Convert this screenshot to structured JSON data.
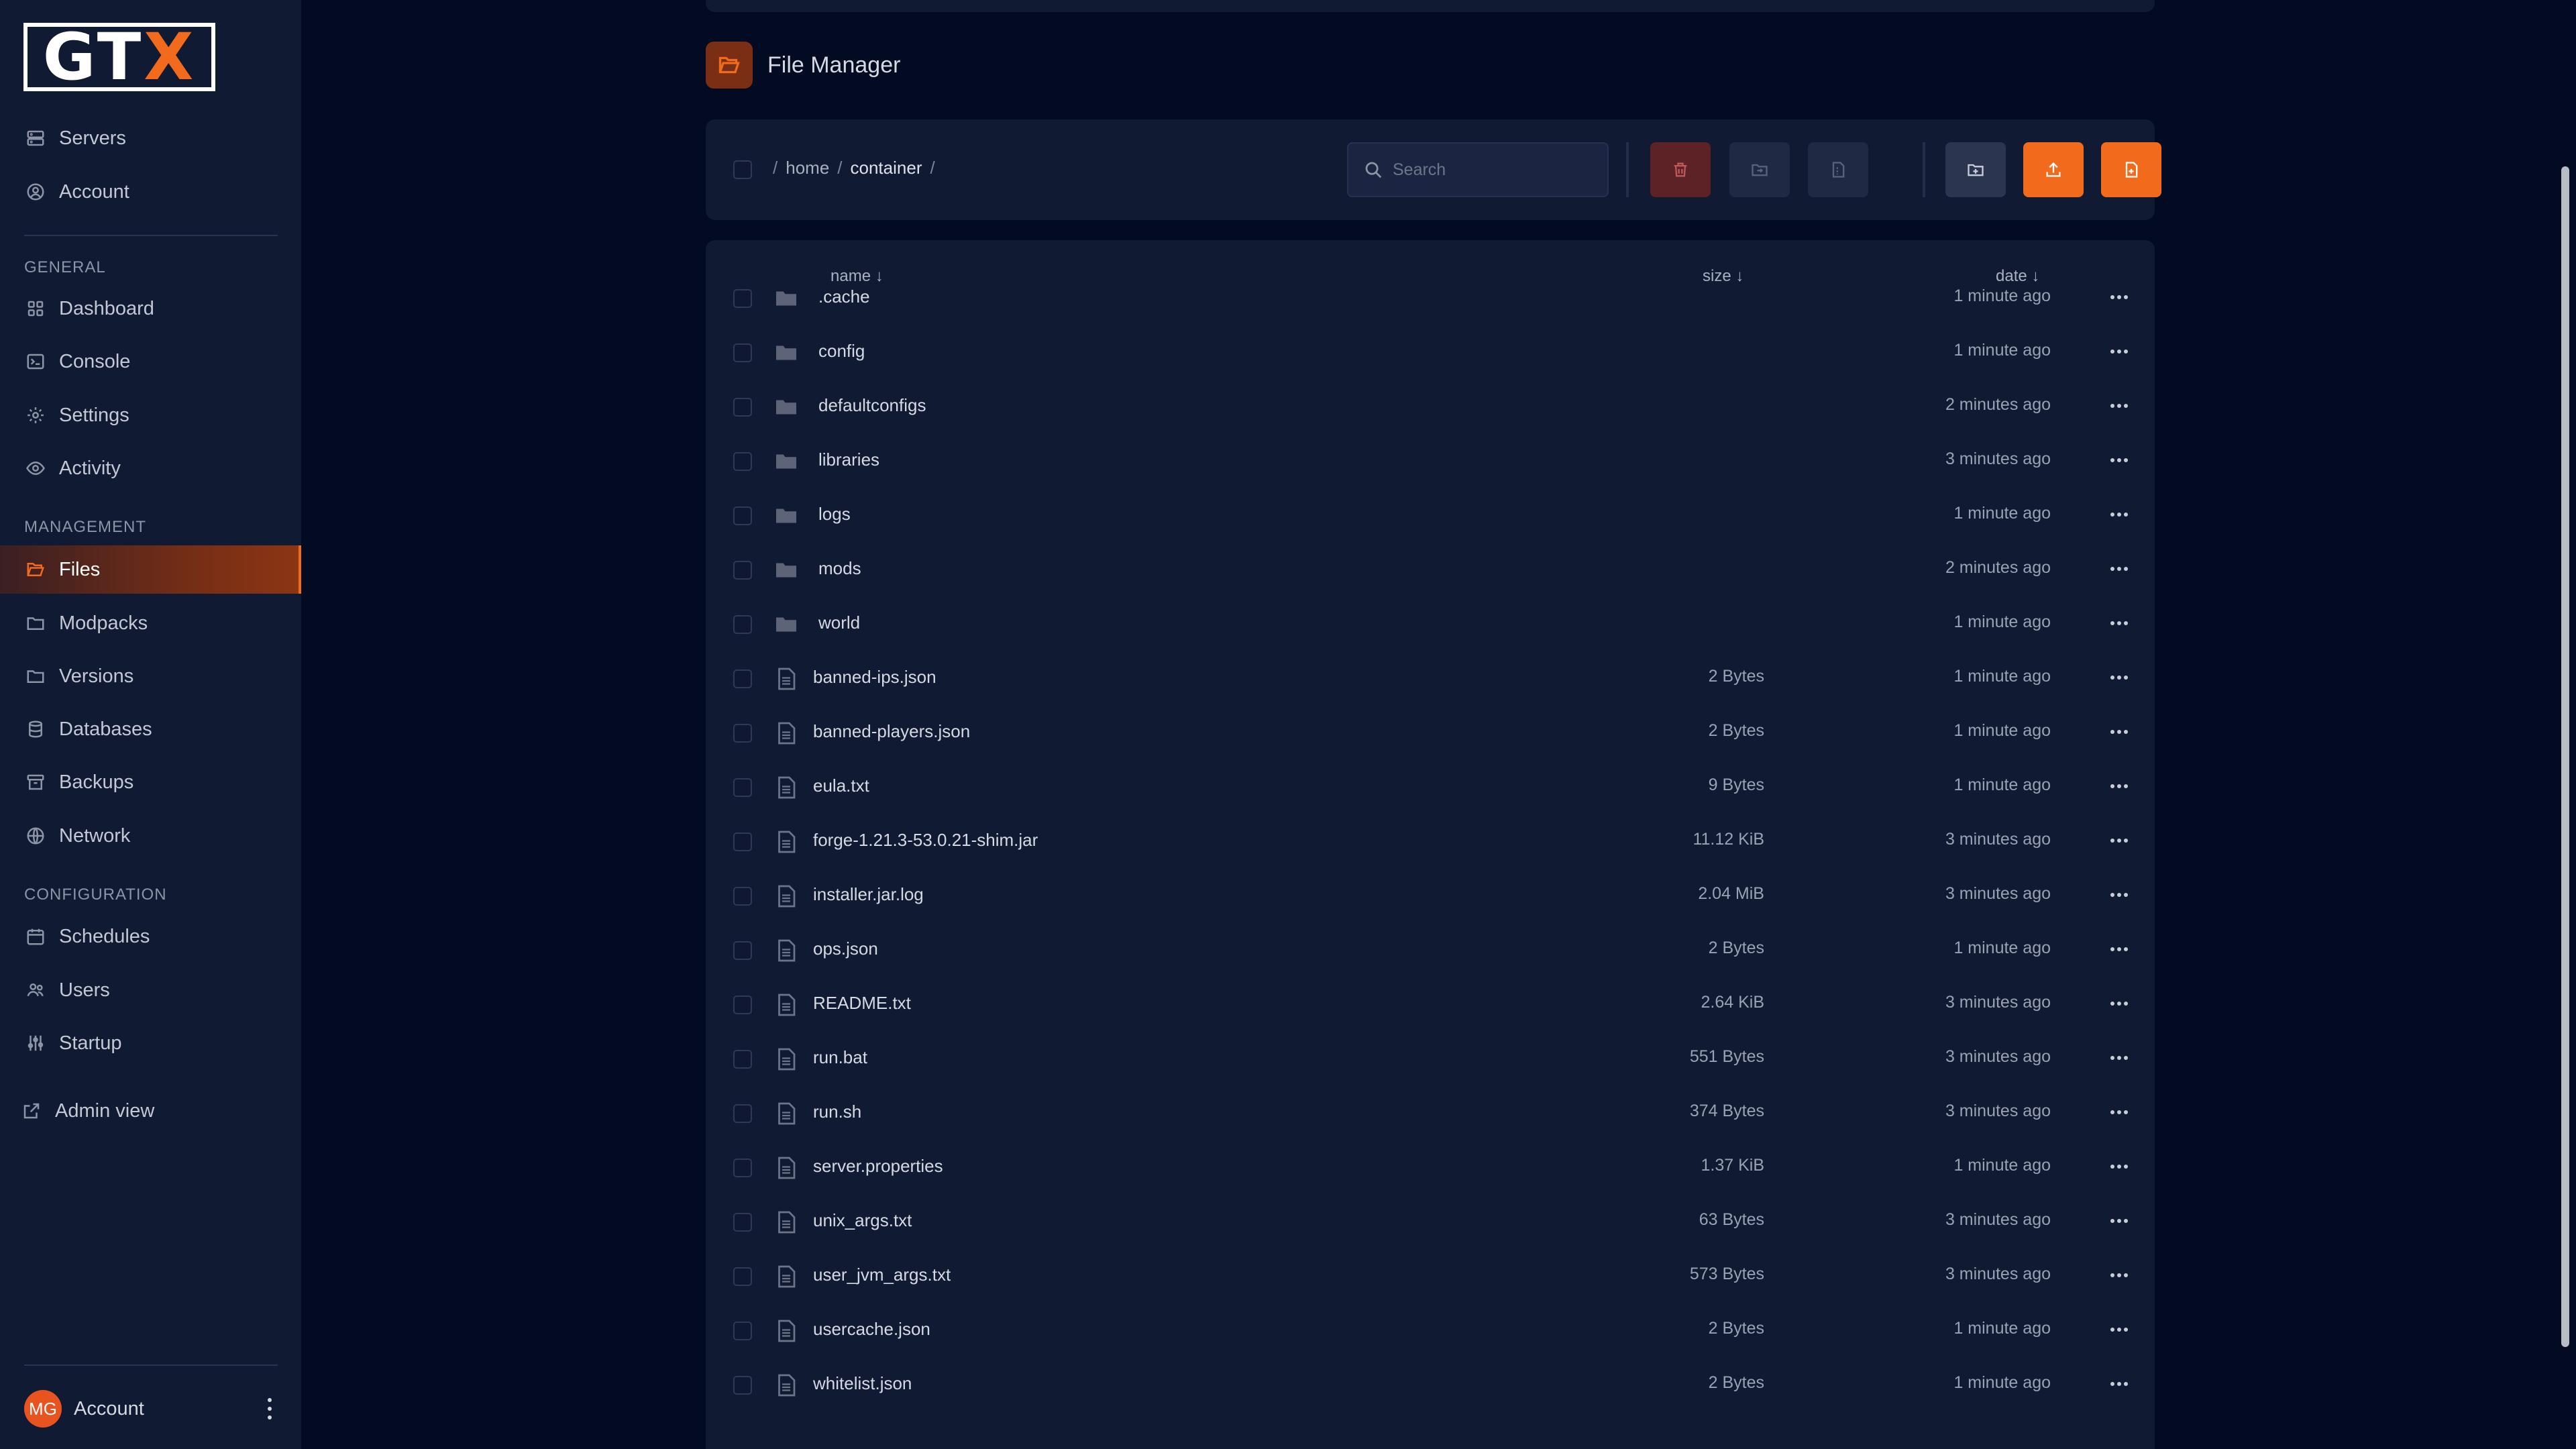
{
  "brand": {
    "logo_main": "GT",
    "logo_accent": "X"
  },
  "sidebar": {
    "top_items": [
      {
        "label": "Servers",
        "icon": "server-icon"
      },
      {
        "label": "Account",
        "icon": "user-circle-icon"
      }
    ],
    "sections": {
      "general": "GENERAL",
      "management": "MANAGEMENT",
      "configuration": "CONFIGURATION"
    },
    "general_items": [
      {
        "label": "Dashboard",
        "icon": "grid-icon"
      },
      {
        "label": "Console",
        "icon": "terminal-icon"
      },
      {
        "label": "Settings",
        "icon": "gear-icon"
      },
      {
        "label": "Activity",
        "icon": "eye-icon"
      }
    ],
    "management_items": [
      {
        "label": "Files",
        "icon": "folder-open-icon",
        "active": true
      },
      {
        "label": "Modpacks",
        "icon": "folder-icon"
      },
      {
        "label": "Versions",
        "icon": "folder-icon"
      },
      {
        "label": "Databases",
        "icon": "database-icon"
      },
      {
        "label": "Backups",
        "icon": "archive-icon"
      },
      {
        "label": "Network",
        "icon": "globe-icon"
      }
    ],
    "configuration_items": [
      {
        "label": "Schedules",
        "icon": "calendar-icon"
      },
      {
        "label": "Users",
        "icon": "users-icon"
      },
      {
        "label": "Startup",
        "icon": "sliders-icon"
      }
    ],
    "admin_view": "Admin view",
    "account_bottom": {
      "initials": "MG",
      "label": "Account"
    }
  },
  "page": {
    "title": "File Manager"
  },
  "breadcrumb": {
    "root": "/",
    "seg1": "home",
    "sep": "/",
    "current": "container",
    "trail": "/"
  },
  "search": {
    "placeholder": "Search"
  },
  "table": {
    "headers": {
      "name": "name ↓",
      "size": "size ↓",
      "date": "date ↓"
    },
    "rows": [
      {
        "name": ".cache",
        "type": "folder",
        "size": "",
        "date": "1 minute ago"
      },
      {
        "name": "config",
        "type": "folder",
        "size": "",
        "date": "1 minute ago"
      },
      {
        "name": "defaultconfigs",
        "type": "folder",
        "size": "",
        "date": "2 minutes ago"
      },
      {
        "name": "libraries",
        "type": "folder",
        "size": "",
        "date": "3 minutes ago"
      },
      {
        "name": "logs",
        "type": "folder",
        "size": "",
        "date": "1 minute ago"
      },
      {
        "name": "mods",
        "type": "folder",
        "size": "",
        "date": "2 minutes ago"
      },
      {
        "name": "world",
        "type": "folder",
        "size": "",
        "date": "1 minute ago"
      },
      {
        "name": "banned-ips.json",
        "type": "file",
        "size": "2 Bytes",
        "date": "1 minute ago"
      },
      {
        "name": "banned-players.json",
        "type": "file",
        "size": "2 Bytes",
        "date": "1 minute ago"
      },
      {
        "name": "eula.txt",
        "type": "file",
        "size": "9 Bytes",
        "date": "1 minute ago"
      },
      {
        "name": "forge-1.21.3-53.0.21-shim.jar",
        "type": "file",
        "size": "11.12 KiB",
        "date": "3 minutes ago"
      },
      {
        "name": "installer.jar.log",
        "type": "file",
        "size": "2.04 MiB",
        "date": "3 minutes ago"
      },
      {
        "name": "ops.json",
        "type": "file",
        "size": "2 Bytes",
        "date": "1 minute ago"
      },
      {
        "name": "README.txt",
        "type": "file",
        "size": "2.64 KiB",
        "date": "3 minutes ago"
      },
      {
        "name": "run.bat",
        "type": "file",
        "size": "551 Bytes",
        "date": "3 minutes ago"
      },
      {
        "name": "run.sh",
        "type": "file",
        "size": "374 Bytes",
        "date": "3 minutes ago"
      },
      {
        "name": "server.properties",
        "type": "file",
        "size": "1.37 KiB",
        "date": "1 minute ago"
      },
      {
        "name": "unix_args.txt",
        "type": "file",
        "size": "63 Bytes",
        "date": "3 minutes ago"
      },
      {
        "name": "user_jvm_args.txt",
        "type": "file",
        "size": "573 Bytes",
        "date": "3 minutes ago"
      },
      {
        "name": "usercache.json",
        "type": "file",
        "size": "2 Bytes",
        "date": "1 minute ago"
      },
      {
        "name": "whitelist.json",
        "type": "file",
        "size": "2 Bytes",
        "date": "1 minute ago"
      }
    ]
  },
  "colors": {
    "accent": "#f26b1d",
    "background": "#020b22",
    "panel": "#111a33"
  }
}
